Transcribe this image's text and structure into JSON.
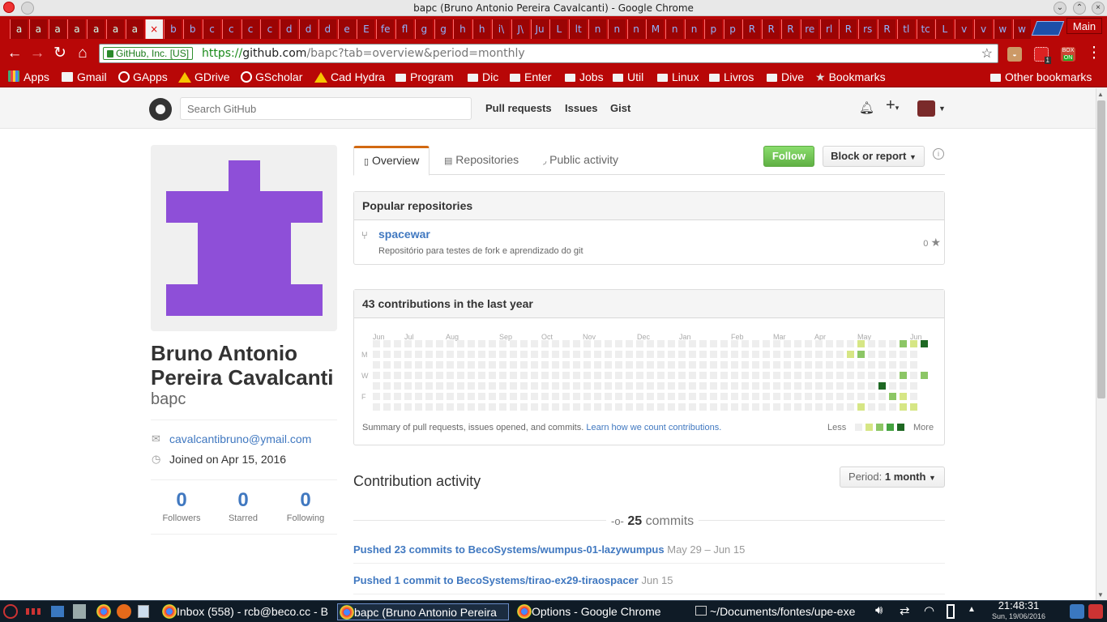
{
  "window": {
    "title": "bapc (Bruno Antonio Pereira Cavalcanti) - Google Chrome"
  },
  "tabs": {
    "labels": [
      "a",
      "a",
      "a",
      "a",
      "a",
      "a",
      "a",
      "×",
      "b",
      "b",
      "c",
      "c",
      "c",
      "c",
      "d",
      "d",
      "d",
      "e",
      "E",
      "fe",
      "fl",
      "g",
      "g",
      "h",
      "h",
      "i\\",
      "J\\",
      "Ju",
      "L",
      "lt",
      "n",
      "n",
      "n",
      "M",
      "n",
      "n",
      "p",
      "p",
      "R",
      "R",
      "R",
      "re",
      "rl",
      "R",
      "rs",
      "R",
      "tl",
      "tc",
      "L",
      "v",
      "v",
      "w",
      "w"
    ],
    "main_label": "Main"
  },
  "toolbar": {
    "secure_label": "GitHub, Inc. [US]",
    "url_scheme": "https://",
    "url_host": "github.com",
    "url_rest": "/bapc?tab=overview&period=monthly",
    "ext_badge_1": "1",
    "ext_badge_2": "ON",
    "ext_label_2": "BOX"
  },
  "bookmarks": {
    "items": [
      "Apps",
      "Gmail",
      "GApps",
      "GDrive",
      "GScholar",
      "Cad Hydra",
      "Program",
      "Dic",
      "Enter",
      "Jobs",
      "Util",
      "Linux",
      "Livros",
      "Dive",
      "Bookmarks"
    ],
    "other": "Other bookmarks"
  },
  "github": {
    "search_placeholder": "Search GitHub",
    "nav": [
      "Pull requests",
      "Issues",
      "Gist"
    ]
  },
  "profile": {
    "fullname": "Bruno Antonio Pereira Cavalcanti",
    "username": "bapc",
    "email": "cavalcantibruno@ymail.com",
    "joined": "Joined on Apr 15, 2016",
    "stats": [
      {
        "value": "0",
        "label": "Followers"
      },
      {
        "value": "0",
        "label": "Starred"
      },
      {
        "value": "0",
        "label": "Following"
      }
    ]
  },
  "profile_tabs": [
    "Overview",
    "Repositories",
    "Public activity"
  ],
  "actions": {
    "follow": "Follow",
    "block": "Block or report",
    "info": "i"
  },
  "popular": {
    "title": "Popular repositories",
    "repos": [
      {
        "name": "spacewar",
        "description": "Repositório para testes de fork e aprendizado do git",
        "stars": "0"
      }
    ]
  },
  "contributions": {
    "title": "43 contributions in the last year",
    "months": [
      "Jun",
      "Jul",
      "Aug",
      "Sep",
      "Oct",
      "Nov",
      "Dec",
      "Jan",
      "Feb",
      "Mar",
      "Apr",
      "May",
      "Jun"
    ],
    "day_labels": [
      "M",
      "W",
      "F"
    ],
    "summary": "Summary of pull requests, issues opened, and commits.",
    "learn_link": "Learn how we count contributions.",
    "less": "Less",
    "more": "More",
    "colors": [
      "#eeeeee",
      "#d6e685",
      "#8cc665",
      "#44a340",
      "#1e6823"
    ],
    "active_cells": [
      {
        "week": 46,
        "day": 0,
        "level": 1
      },
      {
        "week": 46,
        "day": 1,
        "level": 2
      },
      {
        "week": 46,
        "day": 6,
        "level": 1
      },
      {
        "week": 45,
        "day": 1,
        "level": 1
      },
      {
        "week": 49,
        "day": 5,
        "level": 2
      },
      {
        "week": 50,
        "day": 0,
        "level": 2
      },
      {
        "week": 50,
        "day": 3,
        "level": 2
      },
      {
        "week": 50,
        "day": 5,
        "level": 1
      },
      {
        "week": 50,
        "day": 6,
        "level": 1
      },
      {
        "week": 51,
        "day": 0,
        "level": 1
      },
      {
        "week": 51,
        "day": 6,
        "level": 1
      },
      {
        "week": 52,
        "day": 0,
        "level": 4
      },
      {
        "week": 52,
        "day": 3,
        "level": 2
      },
      {
        "week": 48,
        "day": 4,
        "level": 4
      }
    ]
  },
  "activity": {
    "title": "Contribution activity",
    "period_prefix": "Period:",
    "period_value": "1 month",
    "commits_count": "25",
    "commits_word": "commits",
    "rows": [
      {
        "text": "Pushed 23 commits to BecoSystems/wumpus-01-lazywumpus",
        "date": "May 29 – Jun 15"
      },
      {
        "text": "Pushed 1 commit to BecoSystems/tirao-ex29-tiraospacer",
        "date": "Jun 15"
      }
    ]
  },
  "taskbar": {
    "items": [
      {
        "label": "Inbox (558) - rcb@beco.cc - B"
      },
      {
        "label": "bapc (Bruno Antonio Pereira"
      },
      {
        "label": "Options - Google Chrome"
      },
      {
        "label": "~/Documents/fontes/upe-exe"
      }
    ],
    "time": "21:48:31",
    "date": "Sun, 19/06/2016"
  }
}
